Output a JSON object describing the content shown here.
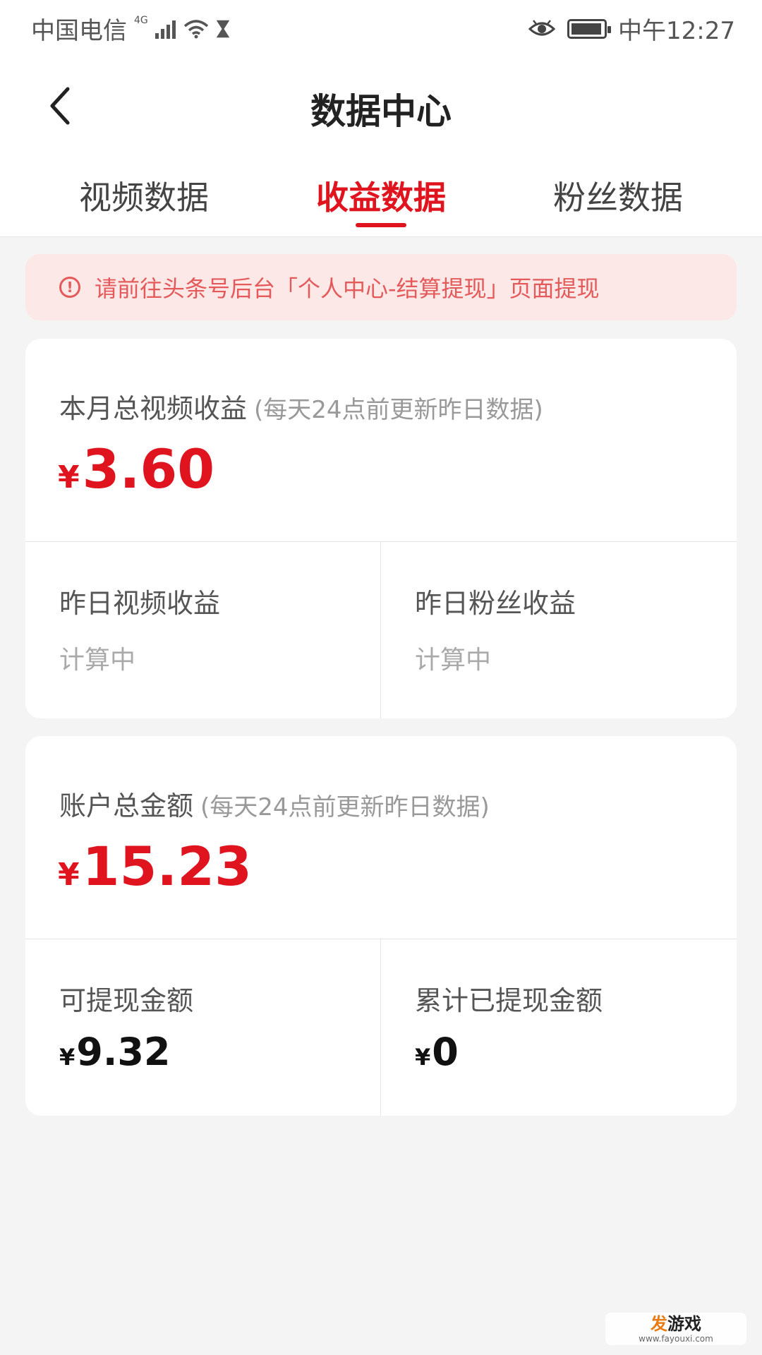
{
  "status_bar": {
    "carrier": "中国电信",
    "network": "4G",
    "time": "中午12:27"
  },
  "nav": {
    "title": "数据中心",
    "back_icon": "chevron-left-icon"
  },
  "tabs": [
    {
      "label": "视频数据",
      "active": false
    },
    {
      "label": "收益数据",
      "active": true
    },
    {
      "label": "粉丝数据",
      "active": false
    }
  ],
  "notice": {
    "icon": "exclamation-circle-icon",
    "text": "请前往头条号后台「个人中心-结算提现」页面提现"
  },
  "monthly": {
    "label": "本月总视频收益",
    "note": "(每天24点前更新昨日数据)",
    "currency": "¥",
    "amount": "3.60",
    "left_label": "昨日视频收益",
    "left_value": "计算中",
    "right_label": "昨日粉丝收益",
    "right_value": "计算中"
  },
  "account": {
    "label": "账户总金额",
    "note": "(每天24点前更新昨日数据)",
    "currency": "¥",
    "amount": "15.23",
    "left_label": "可提现金额",
    "left_amount": "9.32",
    "right_label": "累计已提现金额",
    "right_amount": "0"
  },
  "colors": {
    "accent": "#e0141e",
    "notice_bg": "#fde8e8",
    "notice_text": "#e45a5a",
    "page_bg": "#f4f4f4"
  },
  "watermark": {
    "brand_prefix": "发",
    "brand_rest": "游戏",
    "url": "www.fayouxi.com"
  }
}
